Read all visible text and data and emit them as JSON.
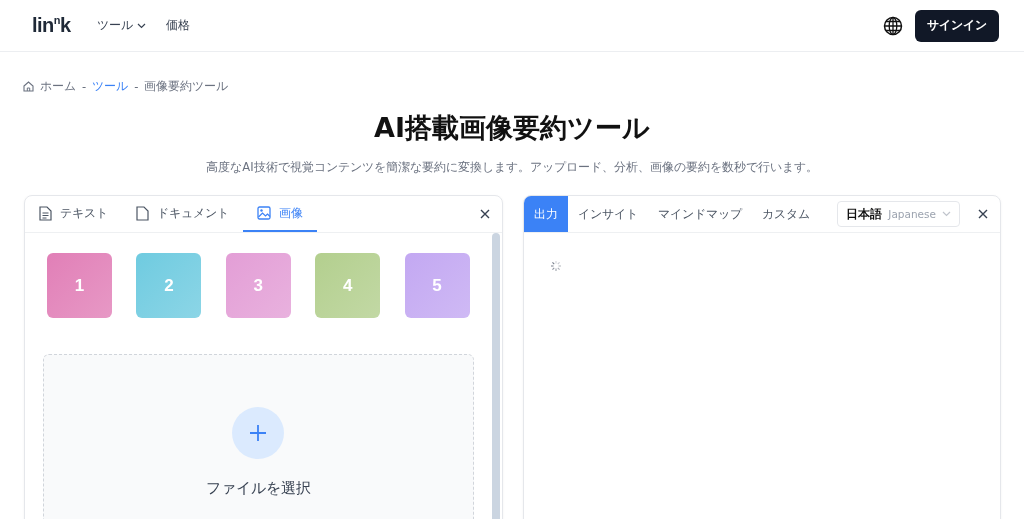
{
  "header": {
    "logo": "lin$^{n}$k",
    "nav": [
      {
        "label": "ツール",
        "dropdown": true
      },
      {
        "label": "価格",
        "dropdown": false
      }
    ],
    "signin": "サインイン"
  },
  "breadcrumb": {
    "separator": "-",
    "items": [
      {
        "label": "ホーム",
        "link": false
      },
      {
        "label": "ツール",
        "link": true
      },
      {
        "label": "画像要約ツール",
        "link": false
      }
    ]
  },
  "title": "AI搭載画像要約ツール",
  "subtitle": "高度なAI技術で視覚コンテンツを簡潔な要約に変換します。アップロード、分析、画像の要約を数秒で行います。",
  "input_panel": {
    "tabs": [
      {
        "label": "テキスト",
        "kind": "text",
        "selected": false
      },
      {
        "label": "ドキュメント",
        "kind": "document",
        "selected": false
      },
      {
        "label": "画像",
        "kind": "image",
        "selected": true
      }
    ],
    "samples": [
      {
        "label": "1",
        "color": "#e17fb7"
      },
      {
        "label": "2",
        "color": "#6fcbe0"
      },
      {
        "label": "3",
        "color": "#e39ed6"
      },
      {
        "label": "4",
        "color": "#b3cf8e"
      },
      {
        "label": "5",
        "color": "#c3a8f2"
      }
    ],
    "upload": {
      "label": "ファイルを選択"
    }
  },
  "output_panel": {
    "tabs": [
      {
        "label": "出力",
        "selected": true
      },
      {
        "label": "インサイト",
        "selected": false
      },
      {
        "label": "マインドマップ",
        "selected": false
      },
      {
        "label": "カスタム",
        "selected": false
      }
    ],
    "language": {
      "native": "日本語",
      "english": "Japanese"
    },
    "loading": true
  }
}
